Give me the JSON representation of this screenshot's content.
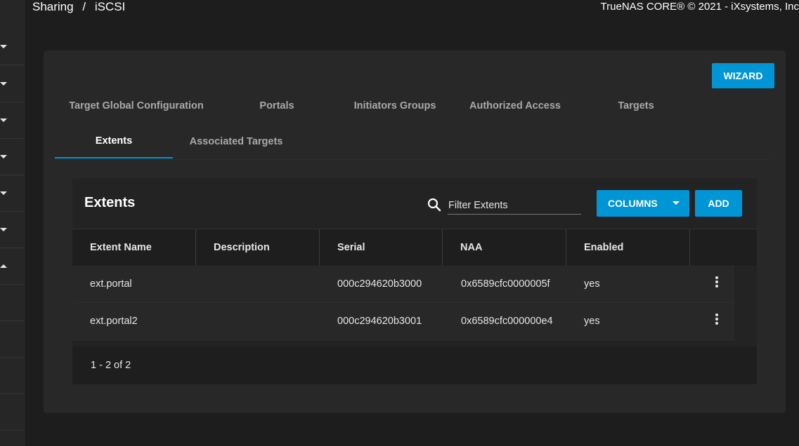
{
  "breadcrumb": {
    "parent": "Sharing",
    "separator": "/",
    "current": "iSCSI"
  },
  "copyright": "TrueNAS CORE® © 2021 - iXsystems, Inc",
  "sidebar": {
    "carets": [
      "down",
      "down",
      "down",
      "down",
      "down",
      "down",
      "up"
    ]
  },
  "wizard_label": "WIZARD",
  "tabs": [
    "Target Global Configuration",
    "Portals",
    "Initiators Groups",
    "Authorized Access",
    "Targets",
    "Extents",
    "Associated Targets"
  ],
  "active_tab": "Extents",
  "panel": {
    "title": "Extents",
    "search_placeholder": "Filter Extents",
    "columns_label": "COLUMNS",
    "add_label": "ADD"
  },
  "table": {
    "headers": [
      "Extent Name",
      "Description",
      "Serial",
      "NAA",
      "Enabled"
    ],
    "rows": [
      [
        "ext.portal",
        "",
        "000c294620b3000",
        "0x6589cfc0000005f",
        "yes"
      ],
      [
        "ext.portal2",
        "",
        "000c294620b3001",
        "0x6589cfc000000e4",
        "yes"
      ]
    ]
  },
  "pagination": "1 - 2 of 2",
  "colors": {
    "accent": "#0095d5",
    "background": "#1d1d1d",
    "card": "#282828"
  }
}
